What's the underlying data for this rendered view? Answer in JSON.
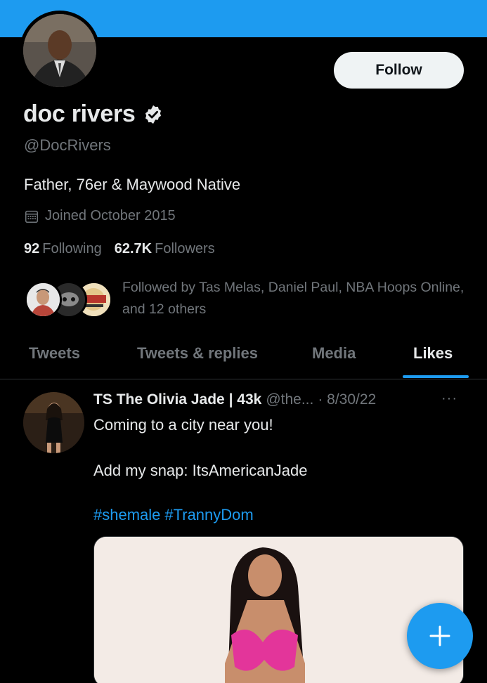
{
  "profile": {
    "display_name": "doc rivers",
    "handle": "@DocRivers",
    "bio": "Father, 76er & Maywood Native",
    "joined": "Joined October 2015",
    "following_count": "92",
    "following_label": "Following",
    "followers_count": "62.7K",
    "followers_label": "Followers",
    "followed_by": "Followed by Tas Melas, Daniel Paul, NBA Hoops Online, and 12 others",
    "follow_label": "Follow",
    "verified": true
  },
  "tabs": [
    {
      "label": "Tweets"
    },
    {
      "label": "Tweets & replies"
    },
    {
      "label": "Media"
    },
    {
      "label": "Likes",
      "active": true
    }
  ],
  "tweet": {
    "author": "TS The Olivia Jade | 43k",
    "handle": "@the...",
    "date": "· 8/30/22",
    "more": "···",
    "line1": "Coming to a city near you!",
    "line2": "Add my snap: ItsAmericanJade",
    "hashtags": [
      "#shemale",
      "#TrannyDom"
    ]
  },
  "fab": {
    "icon": "plus-icon"
  },
  "colors": {
    "accent": "#1d9bf0",
    "background": "#000000",
    "muted": "#71767b",
    "text": "#e7e9ea"
  }
}
